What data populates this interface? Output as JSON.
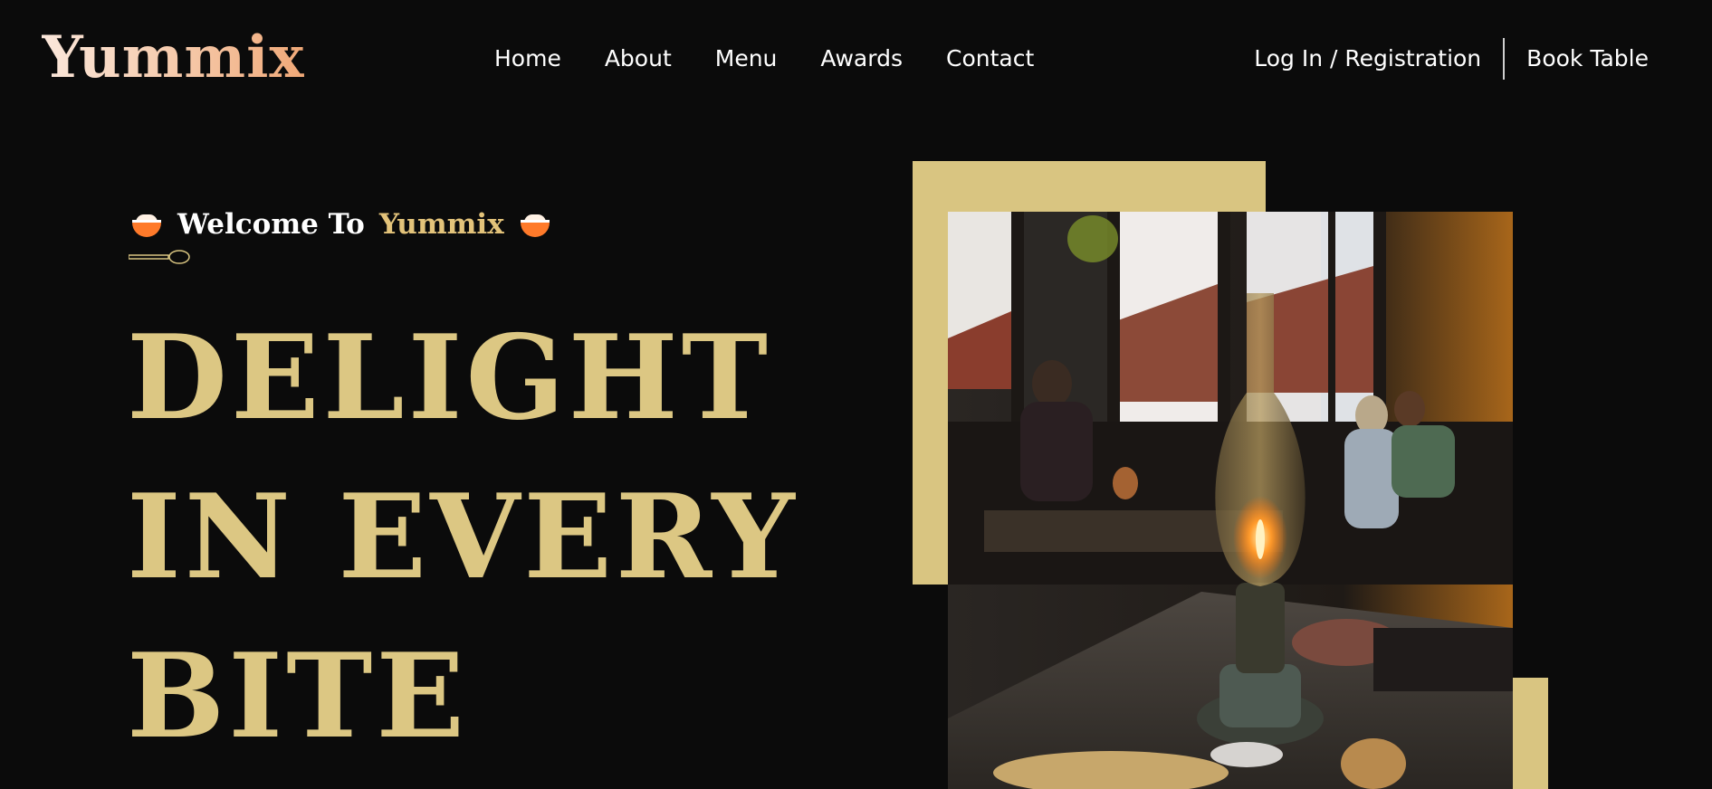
{
  "header": {
    "logo": "Yummix",
    "nav": [
      "Home",
      "About",
      "Menu",
      "Awards",
      "Contact"
    ],
    "login_label": "Log In / Registration",
    "book_label": "Book Table"
  },
  "hero": {
    "welcome_prefix": "Welcome To",
    "welcome_brand": "Yummix",
    "headline_lines": [
      "DELIGHT",
      "IN EVERY",
      "BITE"
    ]
  },
  "colors": {
    "background": "#0b0b0b",
    "accent_gold": "#d9c581",
    "headline": "#dcc783",
    "logo_gradient_start": "#fbe7db",
    "logo_gradient_end": "#f0a877"
  },
  "icons": [
    "bowl-icon",
    "spoon-divider-icon"
  ]
}
